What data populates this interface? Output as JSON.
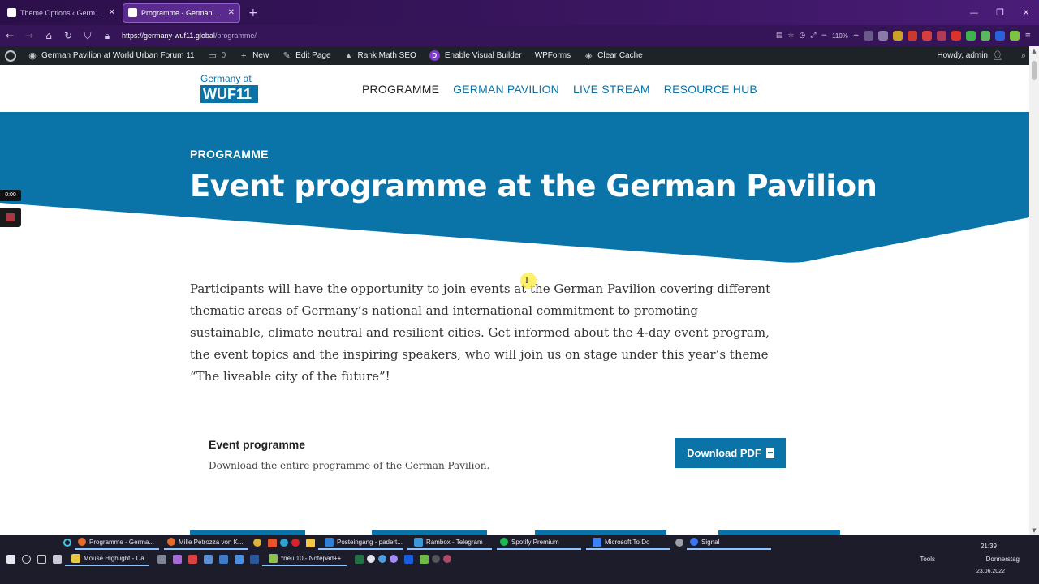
{
  "browser": {
    "tabs": [
      {
        "label": "Theme Options ‹ German Pavil",
        "active": false
      },
      {
        "label": "Programme - German Pavilion",
        "active": true
      }
    ],
    "url_host": "https://germany-wuf11.global",
    "url_path": "/programme/",
    "zoom": "110%"
  },
  "adminbar": {
    "site_name": "German Pavilion at World Urban Forum 11",
    "comments_count": "0",
    "new_label": "New",
    "edit_page_label": "Edit Page",
    "rank_math_label": "Rank Math SEO",
    "divi_label": "Enable Visual Builder",
    "wpforms_label": "WPForms",
    "clear_cache_label": "Clear Cache",
    "howdy_label": "Howdy, admin"
  },
  "site": {
    "logo_line1": "Germany at",
    "logo_line2": "WUF11",
    "nav": [
      {
        "label": "PROGRAMME",
        "current": true
      },
      {
        "label": "GERMAN PAVILION",
        "current": false
      },
      {
        "label": "LIVE STREAM",
        "current": false
      },
      {
        "label": "RESOURCE HUB",
        "current": false
      }
    ],
    "accent_color": "#0a73a8"
  },
  "hero": {
    "eyebrow": "PROGRAMME",
    "title": "Event programme at the German Pavilion"
  },
  "intro": {
    "text": "Participants will have the opportunity to join events at the German Pavilion covering different thematic areas of Germany’s national and international commitment to promoting sustainable, climate neutral and resilient cities. Get informed about the 4-day event program, the event topics and the inspiring speakers, who will join us on stage under this year’s theme “The liveable city of the future”!"
  },
  "event_programme": {
    "title": "Event programme",
    "description": "Download the entire programme of the German Pavilion.",
    "button_label": "Download PDF"
  },
  "recorder": {
    "time": "0:00"
  },
  "taskbar": {
    "row1": [
      "Programme - Germa...",
      "Mille Petrozza von K...",
      "Posteingang - padert...",
      "Rambox - Telegram",
      "Spotify Premium",
      "Microsoft To Do",
      "Signal"
    ],
    "row2": [
      "Mouse Highlight - Ca...",
      "*neu 10 - Notepad++"
    ],
    "tools_label": "Tools",
    "time": "21:39",
    "day": "Donnerstag",
    "date": "23.06.2022"
  }
}
